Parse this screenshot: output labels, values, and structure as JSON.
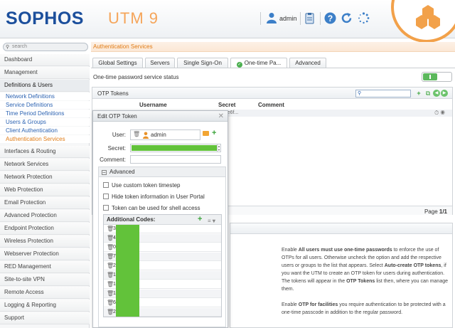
{
  "header": {
    "logo": "SOPHOS",
    "product": "UTM 9",
    "username": "admin"
  },
  "search": {
    "placeholder": "search"
  },
  "sidebar": {
    "items": [
      {
        "label": "Dashboard"
      },
      {
        "label": "Management"
      },
      {
        "label": "Definitions & Users"
      },
      {
        "label": "Interfaces & Routing"
      },
      {
        "label": "Network Services"
      },
      {
        "label": "Network Protection"
      },
      {
        "label": "Web Protection"
      },
      {
        "label": "Email Protection"
      },
      {
        "label": "Advanced Protection"
      },
      {
        "label": "Endpoint Protection"
      },
      {
        "label": "Wireless Protection"
      },
      {
        "label": "Webserver Protection"
      },
      {
        "label": "RED Management"
      },
      {
        "label": "Site-to-site VPN"
      },
      {
        "label": "Remote Access"
      },
      {
        "label": "Logging & Reporting"
      },
      {
        "label": "Support"
      }
    ],
    "subitems": [
      {
        "label": "Network Definitions"
      },
      {
        "label": "Service Definitions"
      },
      {
        "label": "Time Period Definitions"
      },
      {
        "label": "Users & Groups"
      },
      {
        "label": "Client Authentication"
      },
      {
        "label": "Authentication Services"
      }
    ]
  },
  "breadcrumb": "Authentication Services",
  "tabs": [
    {
      "label": "Global Settings"
    },
    {
      "label": "Servers"
    },
    {
      "label": "Single Sign-On"
    },
    {
      "label": "One-time Pa..."
    },
    {
      "label": "Advanced"
    }
  ],
  "otp_status_label": "One-time password service status",
  "otp_tokens": {
    "title": "OTP Tokens",
    "columns": [
      "Username",
      "Secret",
      "Comment"
    ],
    "row_secret": "a45e6f...",
    "page_label": "Page",
    "page_value": "1/1"
  },
  "help": {
    "p1_a": "Enable ",
    "p1_b": "All users must use one-time passwords",
    "p1_c": " to enforce the use of OTPs for all users. Otherwise uncheck the option and add the respective users or groups to the list that appears. Select ",
    "p1_d": "Auto-create OTP tokens",
    "p1_e": ", if you want the UTM to create an OTP token for users during authentication. The tokens will appear in the ",
    "p1_f": "OTP Tokens",
    "p1_g": " list then, where you can manage them.",
    "p2_a": "Enable ",
    "p2_b": "OTP for facilities",
    "p2_c": " you require authentication to be protected with a one-time passcode in addition to the regular password."
  },
  "dialog": {
    "title": "Edit OTP Token",
    "user_label": "User:",
    "user_value": "admin",
    "secret_label": "Secret:",
    "comment_label": "Comment:",
    "advanced_label": "Advanced",
    "chk1": "Use custom token timestep",
    "chk2": "Hide token information in User Portal",
    "chk3": "Token can be used for shell access",
    "codes_label": "Additional Codes:",
    "code_fragments": [
      "3",
      "4",
      "0",
      "7",
      "2",
      "1",
      "1",
      "1",
      "6",
      "2"
    ]
  },
  "colors": {
    "brand_blue": "#1c4f9c",
    "accent_orange": "#e07b14",
    "green": "#62c23a"
  }
}
